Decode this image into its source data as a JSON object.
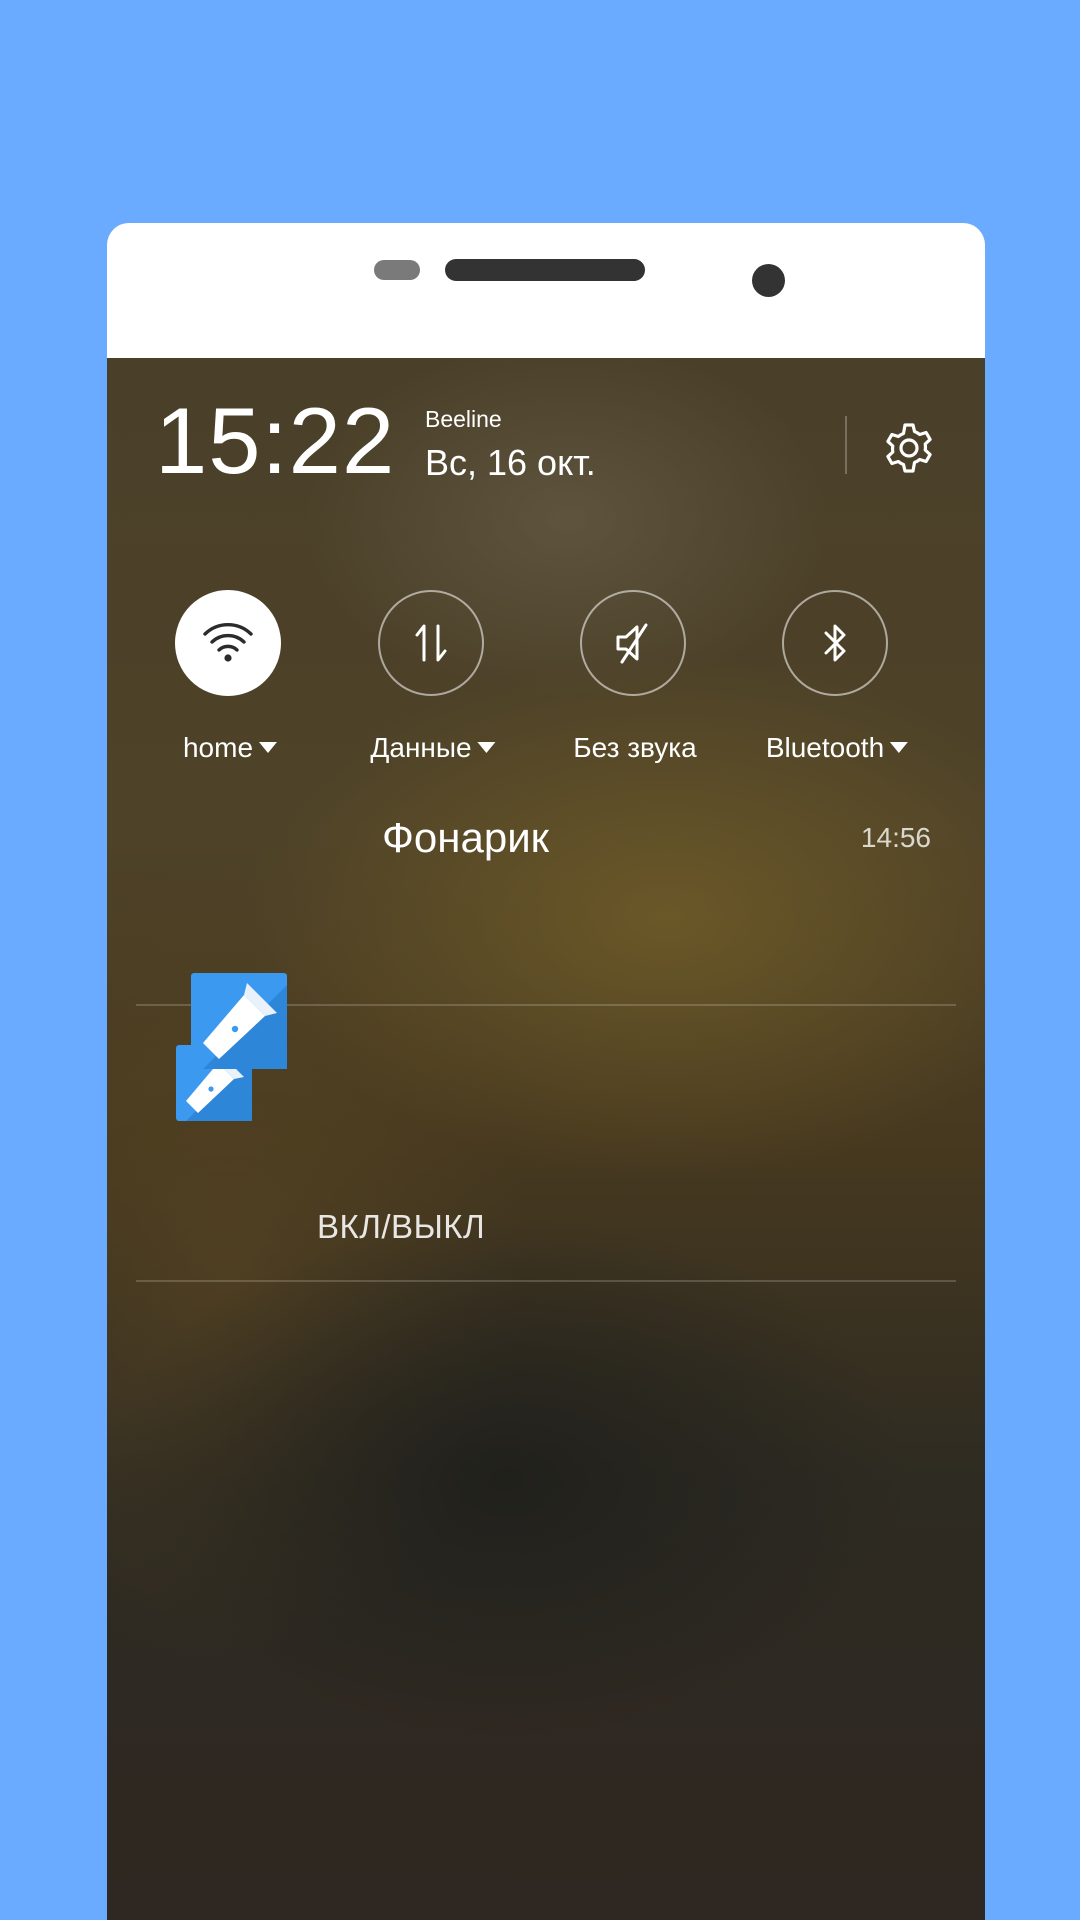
{
  "status": {
    "time": "15:22",
    "operator": "Beeline",
    "date": "Вс, 16 окт."
  },
  "icons": {
    "settings": "gear-icon",
    "wifi": "wifi-icon",
    "data": "data-transfer-icon",
    "sound": "mute-icon",
    "bluetooth": "bluetooth-icon",
    "app": "flashlight-icon"
  },
  "toggles": [
    {
      "label": "home",
      "active": true,
      "has_menu": true
    },
    {
      "label": "Данные",
      "active": false,
      "has_menu": true
    },
    {
      "label": "Без звука",
      "active": false,
      "has_menu": false
    },
    {
      "label": "Bluetooth",
      "active": false,
      "has_menu": true
    }
  ],
  "notification": {
    "app_name": "Фонарик",
    "time": "14:56",
    "action_label": "ВКЛ/ВЫКЛ"
  },
  "colors": {
    "background": "#6aabff",
    "icon_blue": "#3b9af0",
    "icon_blue_light": "#5cb3f7"
  }
}
